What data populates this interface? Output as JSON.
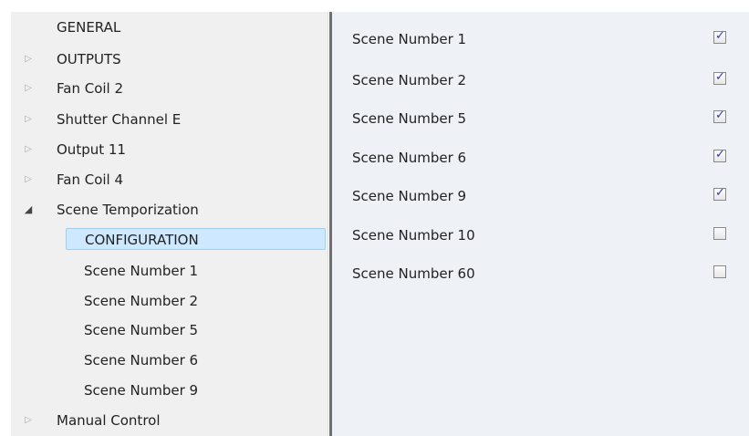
{
  "tree": {
    "items": [
      {
        "label": "GENERAL",
        "arrow": ""
      },
      {
        "label": "OUTPUTS",
        "arrow": "▷"
      },
      {
        "label": "Fan Coil 2",
        "arrow": "▷"
      },
      {
        "label": "Shutter Channel E",
        "arrow": "▷"
      },
      {
        "label": "Output 11",
        "arrow": "▷"
      },
      {
        "label": "Fan Coil 4",
        "arrow": "▷"
      },
      {
        "label": "Scene Temporization",
        "arrow": "◢"
      },
      {
        "label": "CONFIGURATION",
        "arrow": ""
      },
      {
        "label": "Scene Number 1",
        "arrow": ""
      },
      {
        "label": "Scene Number 2",
        "arrow": ""
      },
      {
        "label": "Scene Number 5",
        "arrow": ""
      },
      {
        "label": "Scene Number 6",
        "arrow": ""
      },
      {
        "label": "Scene Number 9",
        "arrow": ""
      },
      {
        "label": "Manual Control",
        "arrow": "▷"
      }
    ]
  },
  "content": {
    "rows": [
      {
        "label": "Scene Number 1",
        "checked": true,
        "mark": "✓"
      },
      {
        "label": "Scene Number 2",
        "checked": true,
        "mark": "✓"
      },
      {
        "label": "Scene Number 5",
        "checked": true,
        "mark": "✓"
      },
      {
        "label": "Scene Number 6",
        "checked": true,
        "mark": "✓"
      },
      {
        "label": "Scene Number 9",
        "checked": true,
        "mark": "✓"
      },
      {
        "label": "Scene Number 10",
        "checked": false,
        "mark": ""
      },
      {
        "label": "Scene Number 60",
        "checked": false,
        "mark": ""
      }
    ]
  }
}
